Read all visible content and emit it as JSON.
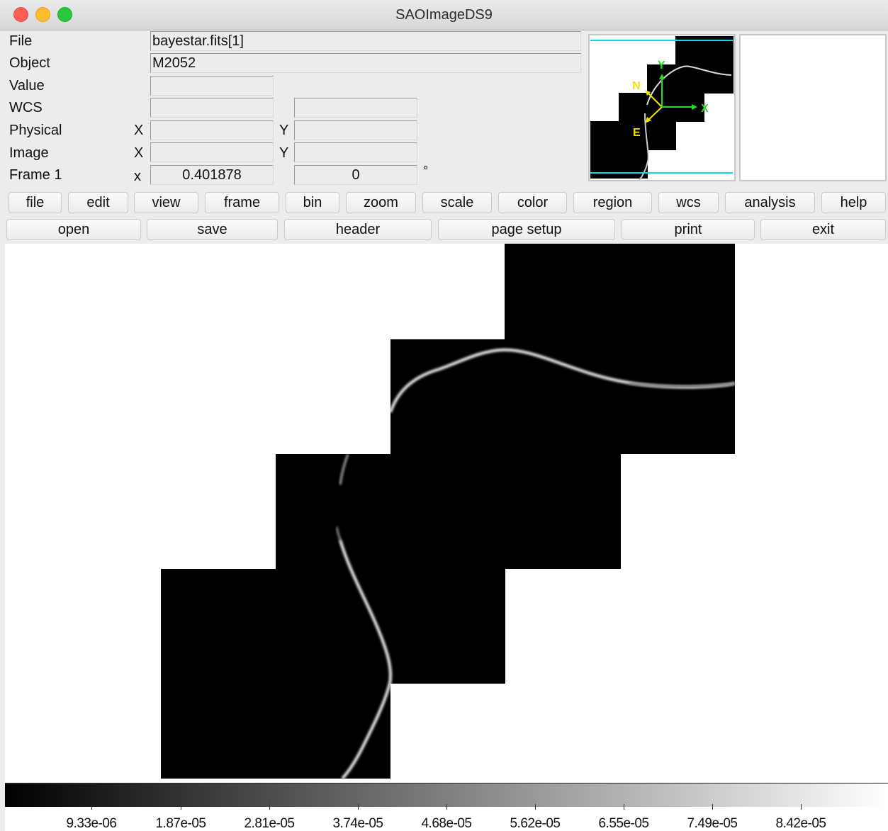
{
  "window": {
    "title": "SAOImageDS9"
  },
  "info_panel": {
    "file_label": "File",
    "file_value": "bayestar.fits[1]",
    "object_label": "Object",
    "object_value": "M2052",
    "value_label": "Value",
    "value_value": "",
    "wcs_label": "WCS",
    "wcs_value_1": "",
    "wcs_value_2": "",
    "physical_label": "Physical",
    "physical_x_label": "X",
    "physical_x_value": "",
    "physical_y_label": "Y",
    "physical_y_value": "",
    "image_label": "Image",
    "image_x_label": "X",
    "image_x_value": "",
    "image_y_label": "Y",
    "image_y_value": "",
    "frame_label": "Frame 1",
    "frame_x_label": "x",
    "frame_zoom_value": "0.401878",
    "frame_angle_value": "0",
    "frame_angle_unit": "°"
  },
  "panner": {
    "compass_north": "N",
    "compass_east": "E",
    "axis_x": "X",
    "axis_y": "Y",
    "compass_color": "#f2e600",
    "axis_color": "#22dd22",
    "bbox_color": "#00e0f0"
  },
  "menu_bar": {
    "items": [
      "file",
      "edit",
      "view",
      "frame",
      "bin",
      "zoom",
      "scale",
      "color",
      "region",
      "wcs",
      "analysis",
      "help"
    ]
  },
  "button_bar": {
    "items": [
      "open",
      "save",
      "header",
      "page setup",
      "print",
      "exit"
    ]
  },
  "colorbar": {
    "gradient_start": "#000000",
    "gradient_end": "#ffffff",
    "tick_labels": [
      "9.33e-06",
      "1.87e-05",
      "2.81e-05",
      "3.74e-05",
      "4.68e-05",
      "5.62e-05",
      "6.55e-05",
      "7.49e-05",
      "8.42e-05"
    ]
  }
}
